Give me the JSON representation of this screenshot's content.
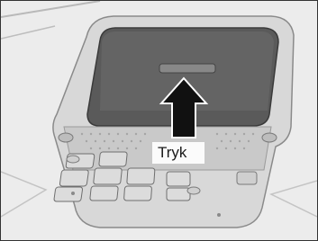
{
  "illustration": {
    "subject": "overhead-console-sunshade",
    "arrow_direction": "up",
    "label": "Tryk"
  }
}
